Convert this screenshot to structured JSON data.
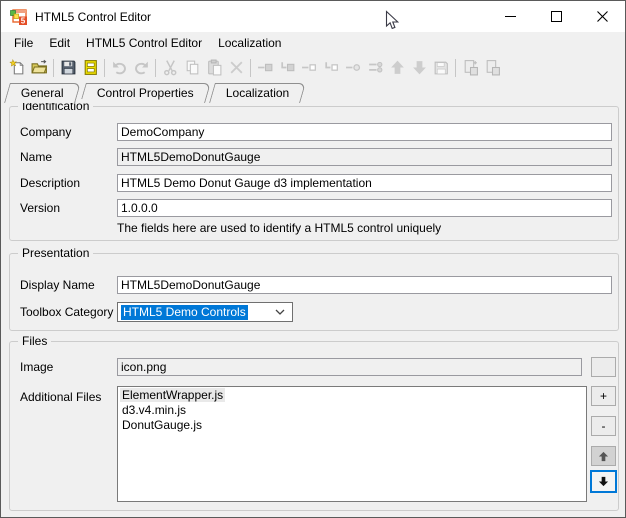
{
  "window": {
    "title": "HTML5 Control Editor",
    "controls": {
      "minimize": "minimize",
      "maximize": "maximize",
      "close": "close"
    }
  },
  "colors": {
    "accent": "#0078d7",
    "titlebar": "#ffffff",
    "surface": "#f0f0f0",
    "readonly_field": "#f0f0f0",
    "selection_text": "#ffffff",
    "disabled_icon": "#c6c6c6"
  },
  "menu": {
    "items": [
      "File",
      "Edit",
      "HTML5 Control Editor",
      "Localization"
    ]
  },
  "toolbar": {
    "items": [
      {
        "name": "new",
        "enabled": true
      },
      {
        "name": "open",
        "enabled": true
      },
      {
        "name": "save",
        "enabled": true
      },
      {
        "name": "save-all",
        "enabled": true
      },
      {
        "name": "undo",
        "enabled": false
      },
      {
        "name": "redo",
        "enabled": false
      },
      {
        "name": "cut",
        "enabled": false
      },
      {
        "name": "copy",
        "enabled": false
      },
      {
        "name": "paste",
        "enabled": false
      },
      {
        "name": "delete",
        "enabled": false
      },
      {
        "name": "add-item",
        "enabled": false
      },
      {
        "name": "add-sub-item",
        "enabled": false
      },
      {
        "name": "add-property",
        "enabled": false
      },
      {
        "name": "add-sub-property",
        "enabled": false
      },
      {
        "name": "add-event",
        "enabled": false
      },
      {
        "name": "add-enum",
        "enabled": false
      },
      {
        "name": "move-up",
        "enabled": false
      },
      {
        "name": "move-down",
        "enabled": false
      },
      {
        "name": "save-as",
        "enabled": false
      },
      {
        "name": "import-localization",
        "enabled": false
      },
      {
        "name": "export-localization",
        "enabled": false
      }
    ]
  },
  "tabs": {
    "items": [
      {
        "label": "General",
        "selected": true
      },
      {
        "label": "Control Properties",
        "selected": false
      },
      {
        "label": "Localization",
        "selected": false
      }
    ]
  },
  "identification": {
    "legend": "Identification",
    "company": {
      "label": "Company",
      "value": "DemoCompany"
    },
    "name": {
      "label": "Name",
      "value": "HTML5DemoDonutGauge",
      "readonly": true
    },
    "description": {
      "label": "Description",
      "value": "HTML5 Demo Donut Gauge d3 implementation"
    },
    "version": {
      "label": "Version",
      "value": "1.0.0.0"
    },
    "note": "The fields here are used to identify a HTML5 control uniquely"
  },
  "presentation": {
    "legend": "Presentation",
    "display_name": {
      "label": "Display Name",
      "value": "HTML5DemoDonutGauge"
    },
    "toolbox_category": {
      "label": "Toolbox Category",
      "value": "HTML5 Demo Controls",
      "selected": true
    }
  },
  "files": {
    "legend": "Files",
    "image": {
      "label": "Image",
      "value": "icon.png",
      "readonly": true
    },
    "additional_files": {
      "label": "Additional Files",
      "items": [
        "ElementWrapper.js",
        "d3.v4.min.js",
        "DonutGauge.js"
      ],
      "selected_index": 0
    },
    "buttons": {
      "add": "+",
      "remove": "-",
      "move_up": "up-arrow",
      "move_down": "down-arrow",
      "browse": ""
    }
  }
}
